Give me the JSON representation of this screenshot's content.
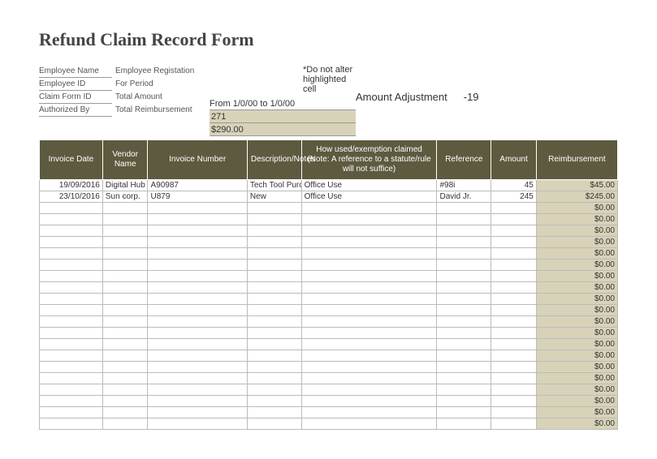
{
  "title": "Refund Claim Record Form",
  "note": "*Do not alter highlighted cell",
  "meta_left_labels": {
    "emp_name": "Employee Name",
    "emp_id": "Employee ID",
    "claim_id": "Claim Form ID",
    "auth_by": "Authorized By"
  },
  "meta_mid_labels": {
    "emp_reg": "Employee Registation",
    "for_period": "For Period",
    "total_amount": "Total Amount",
    "total_reimb": "Total Reimbursement"
  },
  "meta_values": {
    "for_period": "From 1/0/00 to 1/0/00",
    "total_amount": "271",
    "total_reimb": "$290.00"
  },
  "adjustment": {
    "label": "Amount Adjustment",
    "value": "-19"
  },
  "columns": {
    "invoice_date": "Invoice Date",
    "vendor": "Vendor Name",
    "invoice_no": "Invoice Number",
    "desc": "Description/Notes",
    "how": "How used/exemption claimed (Note:  A reference to a statute/rule will not suffice)",
    "reference": "Reference",
    "amount": "Amount",
    "reimb": "Reimbursement"
  },
  "rows": [
    {
      "date": "19/09/2016",
      "vendor": "Digital Hub",
      "invno": "A90987",
      "desc": "Tech Tool Purchasing",
      "how": "Office Use",
      "ref": "#98i",
      "amount": "45",
      "reimb": "$45.00"
    },
    {
      "date": "23/10/2016",
      "vendor": "Sun corp.",
      "invno": "U879",
      "desc": "New",
      "how": "Office Use",
      "ref": "David Jr.",
      "amount": "245",
      "reimb": "$245.00"
    },
    {
      "date": "",
      "vendor": "",
      "invno": "",
      "desc": "",
      "how": "",
      "ref": "",
      "amount": "",
      "reimb": "$0.00"
    },
    {
      "date": "",
      "vendor": "",
      "invno": "",
      "desc": "",
      "how": "",
      "ref": "",
      "amount": "",
      "reimb": "$0.00"
    },
    {
      "date": "",
      "vendor": "",
      "invno": "",
      "desc": "",
      "how": "",
      "ref": "",
      "amount": "",
      "reimb": "$0.00"
    },
    {
      "date": "",
      "vendor": "",
      "invno": "",
      "desc": "",
      "how": "",
      "ref": "",
      "amount": "",
      "reimb": "$0.00"
    },
    {
      "date": "",
      "vendor": "",
      "invno": "",
      "desc": "",
      "how": "",
      "ref": "",
      "amount": "",
      "reimb": "$0.00"
    },
    {
      "date": "",
      "vendor": "",
      "invno": "",
      "desc": "",
      "how": "",
      "ref": "",
      "amount": "",
      "reimb": "$0.00"
    },
    {
      "date": "",
      "vendor": "",
      "invno": "",
      "desc": "",
      "how": "",
      "ref": "",
      "amount": "",
      "reimb": "$0.00"
    },
    {
      "date": "",
      "vendor": "",
      "invno": "",
      "desc": "",
      "how": "",
      "ref": "",
      "amount": "",
      "reimb": "$0.00"
    },
    {
      "date": "",
      "vendor": "",
      "invno": "",
      "desc": "",
      "how": "",
      "ref": "",
      "amount": "",
      "reimb": "$0.00"
    },
    {
      "date": "",
      "vendor": "",
      "invno": "",
      "desc": "",
      "how": "",
      "ref": "",
      "amount": "",
      "reimb": "$0.00"
    },
    {
      "date": "",
      "vendor": "",
      "invno": "",
      "desc": "",
      "how": "",
      "ref": "",
      "amount": "",
      "reimb": "$0.00"
    },
    {
      "date": "",
      "vendor": "",
      "invno": "",
      "desc": "",
      "how": "",
      "ref": "",
      "amount": "",
      "reimb": "$0.00"
    },
    {
      "date": "",
      "vendor": "",
      "invno": "",
      "desc": "",
      "how": "",
      "ref": "",
      "amount": "",
      "reimb": "$0.00"
    },
    {
      "date": "",
      "vendor": "",
      "invno": "",
      "desc": "",
      "how": "",
      "ref": "",
      "amount": "",
      "reimb": "$0.00"
    },
    {
      "date": "",
      "vendor": "",
      "invno": "",
      "desc": "",
      "how": "",
      "ref": "",
      "amount": "",
      "reimb": "$0.00"
    },
    {
      "date": "",
      "vendor": "",
      "invno": "",
      "desc": "",
      "how": "",
      "ref": "",
      "amount": "",
      "reimb": "$0.00"
    },
    {
      "date": "",
      "vendor": "",
      "invno": "",
      "desc": "",
      "how": "",
      "ref": "",
      "amount": "",
      "reimb": "$0.00"
    },
    {
      "date": "",
      "vendor": "",
      "invno": "",
      "desc": "",
      "how": "",
      "ref": "",
      "amount": "",
      "reimb": "$0.00"
    },
    {
      "date": "",
      "vendor": "",
      "invno": "",
      "desc": "",
      "how": "",
      "ref": "",
      "amount": "",
      "reimb": "$0.00"
    },
    {
      "date": "",
      "vendor": "",
      "invno": "",
      "desc": "",
      "how": "",
      "ref": "",
      "amount": "",
      "reimb": "$0.00"
    }
  ]
}
